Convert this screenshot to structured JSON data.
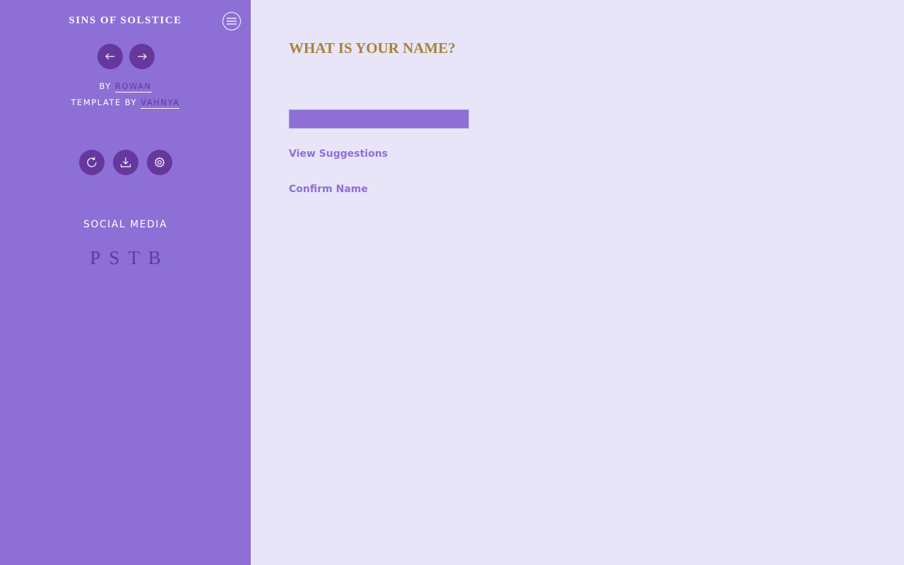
{
  "sidebar": {
    "title": "SINS OF SOLSTICE",
    "menu_icon": "hamburger-menu-icon",
    "nav": {
      "back_icon": "arrow-left-icon",
      "forward_icon": "arrow-right-icon"
    },
    "credits": {
      "by_prefix": "BY",
      "author": "ROWAN",
      "template_prefix": "TEMPLATE BY",
      "template_author": "VAHNYA"
    },
    "tools": {
      "restart_icon": "restart-icon",
      "save_icon": "download-icon",
      "settings_icon": "gear-icon"
    },
    "social": {
      "heading": "SOCIAL MEDIA",
      "links": [
        "P",
        "S",
        "T",
        "B"
      ]
    }
  },
  "main": {
    "question": "WHAT IS YOUR NAME?",
    "name_input": {
      "value": "",
      "placeholder": ""
    },
    "view_suggestions": "View Suggestions",
    "confirm_name": "Confirm Name"
  },
  "colors": {
    "sidebar_bg": "#8d6fd6",
    "main_bg": "#e7e5f7",
    "button_bg": "#66379d",
    "heading_gold": "#a8823a",
    "link_purple": "#8d6fd6"
  }
}
